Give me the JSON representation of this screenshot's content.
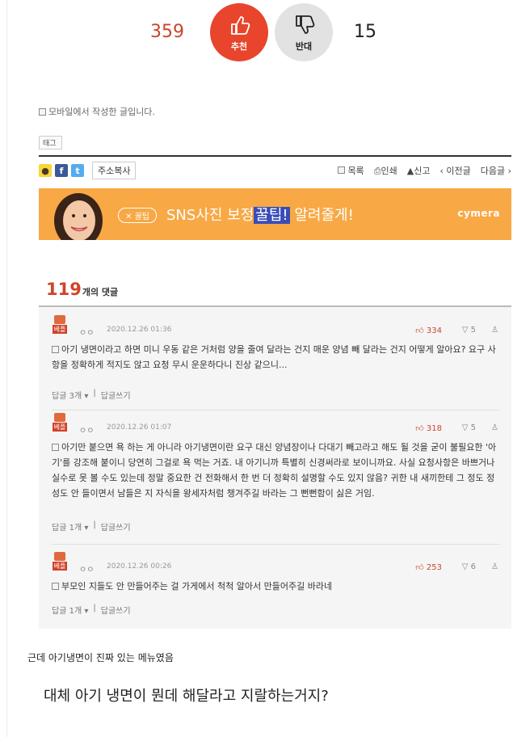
{
  "vote": {
    "up_count": "359",
    "up_label": "추천",
    "down_count": "15",
    "down_label": "반대"
  },
  "post": {
    "mobile_note": "모바일에서 작성한 글입니다.",
    "tag_label": "태그"
  },
  "toolbar": {
    "copy_address": "주소복사",
    "list": "목록",
    "print": "인쇄",
    "report": "신고",
    "prev": "‹ 이전글",
    "next": "다음글 ›"
  },
  "banner": {
    "chip": "꿀팁",
    "text_before": "SNS사진 보정",
    "text_highlight": "꿀팁!",
    "text_after": " 알려줄게!",
    "brand": "cymera",
    "colors": {
      "background": "#f8a845",
      "highlight": "#3a4cb8"
    }
  },
  "comments": {
    "count": "119",
    "count_label": "개의 댓글",
    "items": [
      {
        "badge": "베플",
        "nick": "ㅇㅇ",
        "date": "2020.12.26 01:36",
        "likes": "334",
        "dislikes": "5",
        "body": "아기 냉면이라고 하면 미니 우동 같은 거처럼 양을 줄여 달라는 건지 매운 양념 빼 달라는 건지 어떻게 알아요? 요구 사항을 정확하게 적지도 않고 요청 무시 운운하다니 진상 같으니...",
        "replies": "답글 3개",
        "write_reply": "답글쓰기"
      },
      {
        "badge": "베플",
        "nick": "ㅇㅇ",
        "date": "2020.12.26 01:07",
        "likes": "318",
        "dislikes": "5",
        "body": "아기만 붙으면 욕 하는 게 아니라 아기냉면이란 요구 대신 양념장이나 다대기 빼고라고 해도 될 것을 굳이 불필요한 '아기'를 강조해 붙이니 당연히 그걸로 욕 먹는 거죠. 내 아기니까 특별히 신경써라로 보이니까요. 사실 요청사항은 바쁘거나 실수로 못 볼 수도 있는데 정말 중요한 건 전화해서 한 번 더 정확히 설명할 수도 있지 않음? 귀한 내 새끼한테 그 정도 정성도 안 들이면서 남들은 지 자식을 왕세자처럼 챙겨주길 바라는 그 뻔뻔함이 싫은 거임.",
        "replies": "답글 1개",
        "write_reply": "답글쓰기"
      },
      {
        "badge": "베플",
        "nick": "ㅇㅇ",
        "date": "2020.12.26 00:26",
        "likes": "253",
        "dislikes": "6",
        "body": "부모인 지들도 안 만들어주는 걸 가게에서 척척 알아서 만들어주길 바라네",
        "replies": "답글 1개",
        "write_reply": "답글쓰기"
      }
    ]
  },
  "caption": "근데 아기냉면이 진짜 있는 메뉴였음",
  "question": "대체 아기 냉면이 뭔데 해달라고 지랄하는거지?"
}
